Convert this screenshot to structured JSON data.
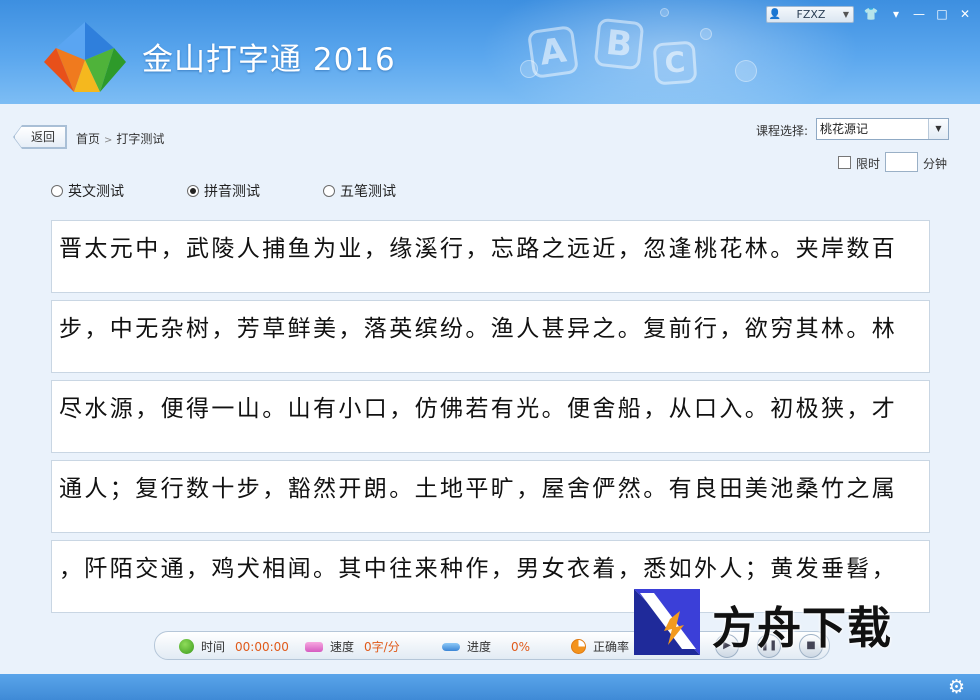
{
  "header": {
    "app_title": "金山打字通 2016",
    "deco_letters": [
      "A",
      "B",
      "C"
    ],
    "user": {
      "name": "FZXZ",
      "icon": "user-icon",
      "dropdown_icon": "chevron-down-icon"
    },
    "window_buttons": [
      {
        "name": "skin-button",
        "icon": "shirt-icon",
        "glyph": "👕"
      },
      {
        "name": "menu-button",
        "icon": "menu-icon",
        "glyph": "▾"
      },
      {
        "name": "minimize-button",
        "icon": "minimize-icon",
        "glyph": "—"
      },
      {
        "name": "maximize-button",
        "icon": "maximize-icon",
        "glyph": "□"
      },
      {
        "name": "close-button",
        "icon": "close-icon",
        "glyph": "✕"
      }
    ]
  },
  "nav": {
    "back_label": "返回",
    "breadcrumb": {
      "home": "首页",
      "separator": ">",
      "current": "打字测试"
    }
  },
  "course": {
    "label": "课程选择:",
    "selected": "桃花源记"
  },
  "time_limit": {
    "checked": false,
    "label": "限时",
    "value": "",
    "unit": "分钟"
  },
  "test_modes": [
    {
      "label": "英文测试",
      "selected": false
    },
    {
      "label": "拼音测试",
      "selected": true
    },
    {
      "label": "五笔测试",
      "selected": false
    }
  ],
  "text_lines": [
    "晋太元中，武陵人捕鱼为业，缘溪行，忘路之远近，忽逢桃花林。夹岸数百",
    "步，中无杂树，芳草鲜美，落英缤纷。渔人甚异之。复前行，欲穷其林。林",
    "尽水源，便得一山。山有小口，仿佛若有光。便舍船，从口入。初极狭，才",
    "通人；复行数十步，豁然开朗。土地平旷，屋舍俨然。有良田美池桑竹之属",
    "，阡陌交通，鸡犬相闻。其中往来种作，男女衣着，悉如外人；黄发垂髫，"
  ],
  "status": {
    "time": {
      "label": "时间",
      "value": "00:00:00",
      "icon": "clock-icon"
    },
    "speed": {
      "label": "速度",
      "value": "0字/分",
      "icon": "speed-icon"
    },
    "progress": {
      "label": "进度",
      "value": "0%",
      "icon": "progress-icon"
    },
    "accuracy": {
      "label": "正确率",
      "icon": "accuracy-icon"
    }
  },
  "controls": [
    "play-icon",
    "pause-icon",
    "stop-icon"
  ],
  "settings_icon": "gear-icon",
  "watermark": {
    "text": "方舟下载"
  },
  "colors": {
    "header_blue": "#4a9ae6",
    "status_value": "#e05a1a",
    "bottom_bar": "#4a95df"
  }
}
